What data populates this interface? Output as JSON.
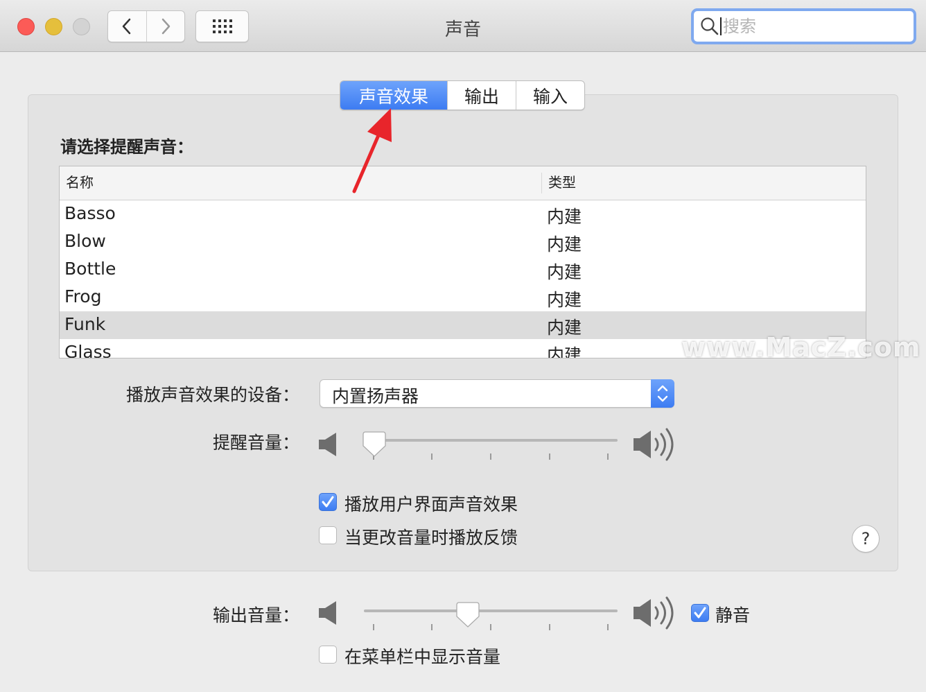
{
  "window": {
    "title": "声音",
    "search_placeholder": "搜索"
  },
  "tabs": [
    {
      "label": "声音效果",
      "active": true
    },
    {
      "label": "输出",
      "active": false
    },
    {
      "label": "输入",
      "active": false
    }
  ],
  "sound_effects": {
    "section_label": "请选择提醒声音：",
    "table": {
      "columns": [
        "名称",
        "类型"
      ],
      "rows": [
        {
          "name": "Basso",
          "type": "内建"
        },
        {
          "name": "Blow",
          "type": "内建"
        },
        {
          "name": "Bottle",
          "type": "内建"
        },
        {
          "name": "Frog",
          "type": "内建"
        },
        {
          "name": "Funk",
          "type": "内建",
          "selected": true
        },
        {
          "name": "Glass",
          "type": "内建"
        }
      ]
    },
    "device_label": "播放声音效果的设备：",
    "device_value": "内置扬声器",
    "alert_volume_label": "提醒音量：",
    "alert_volume_level": 0.04,
    "play_ui_sounds_label": "播放用户界面声音效果",
    "play_ui_sounds_checked": true,
    "volume_feedback_label": "当更改音量时播放反馈",
    "volume_feedback_checked": false,
    "help_label": "?"
  },
  "output": {
    "volume_label": "输出音量：",
    "volume_level": 0.41,
    "mute_label": "静音",
    "mute_checked": true,
    "show_in_menubar_label": "在菜单栏中显示音量",
    "show_in_menubar_checked": false
  },
  "watermark": {
    "logo_letter": "Z",
    "text": "www.MacZ.com"
  },
  "colors": {
    "accent": "#3d7cf2",
    "close": "#fc5b57",
    "minimize": "#e5bf3c",
    "zoom_disabled": "#d3d3d3",
    "annotation_arrow": "#e8252b",
    "watermark_logo": "#f05a24"
  }
}
